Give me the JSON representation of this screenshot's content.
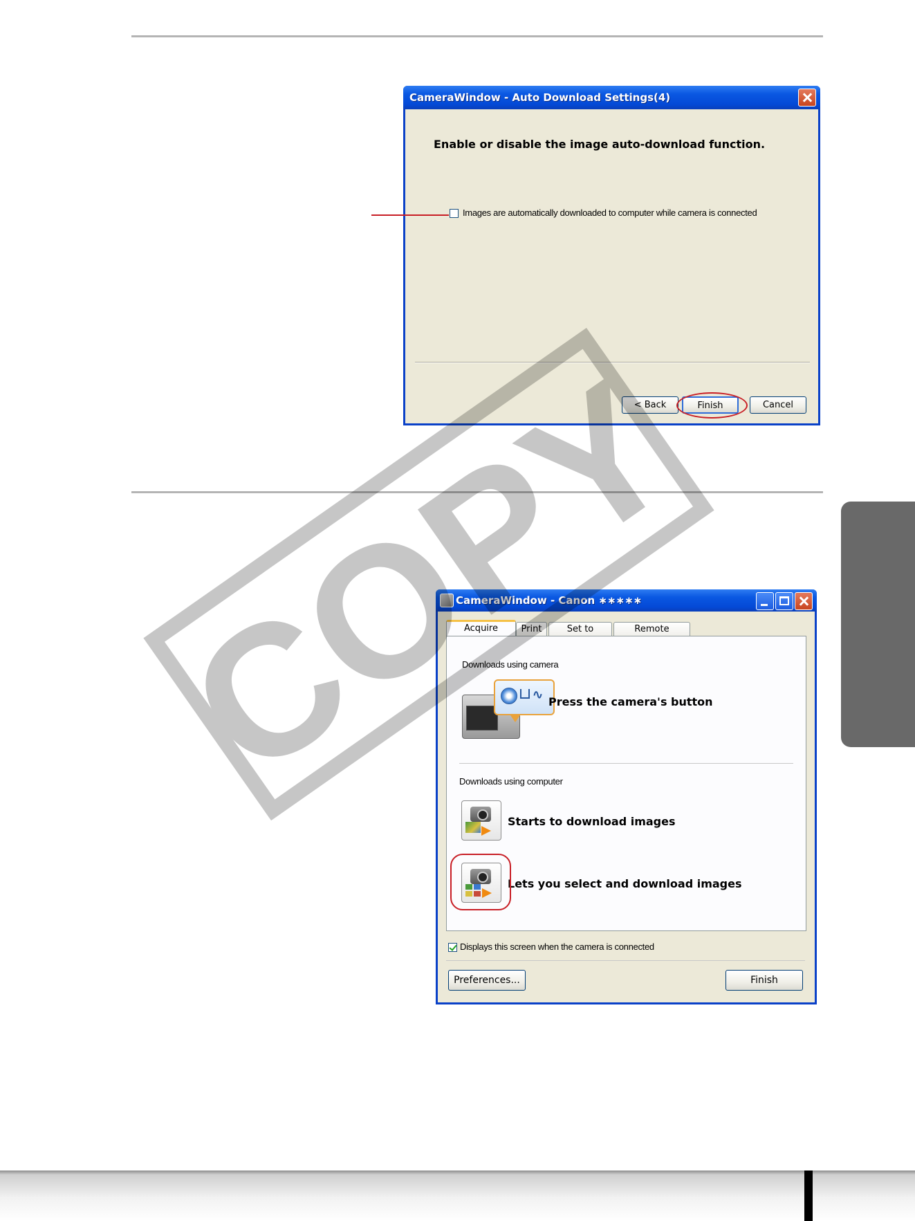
{
  "watermark": "COPY",
  "dialog1": {
    "title": "CameraWindow - Auto Download Settings(4)",
    "heading": "Enable or disable the image auto-download function.",
    "checkbox_label": "Images are automatically downloaded to computer while camera is connected",
    "checkbox_checked": false,
    "buttons": {
      "back": "< Back",
      "finish": "Finish",
      "cancel": "Cancel"
    }
  },
  "dialog2": {
    "title": "CameraWindow - Canon ∗∗∗∗∗",
    "tabs": [
      "Acquire Images",
      "Print",
      "Set to Camera",
      "Remote shooting"
    ],
    "active_tab": "Acquire Images",
    "section_camera": {
      "label": "Downloads using camera",
      "action": "Press the camera's button"
    },
    "section_computer": {
      "label": "Downloads using computer",
      "actions": [
        "Starts to download images",
        "Lets you select and download images"
      ]
    },
    "show_on_connect_label": "Displays this screen when the camera is connected",
    "show_on_connect_checked": true,
    "buttons": {
      "preferences": "Preferences...",
      "finish": "Finish"
    }
  },
  "colors": {
    "callout_red": "#c81e25",
    "xp_blue": "#0a58e2",
    "side_tab": "#696969"
  }
}
